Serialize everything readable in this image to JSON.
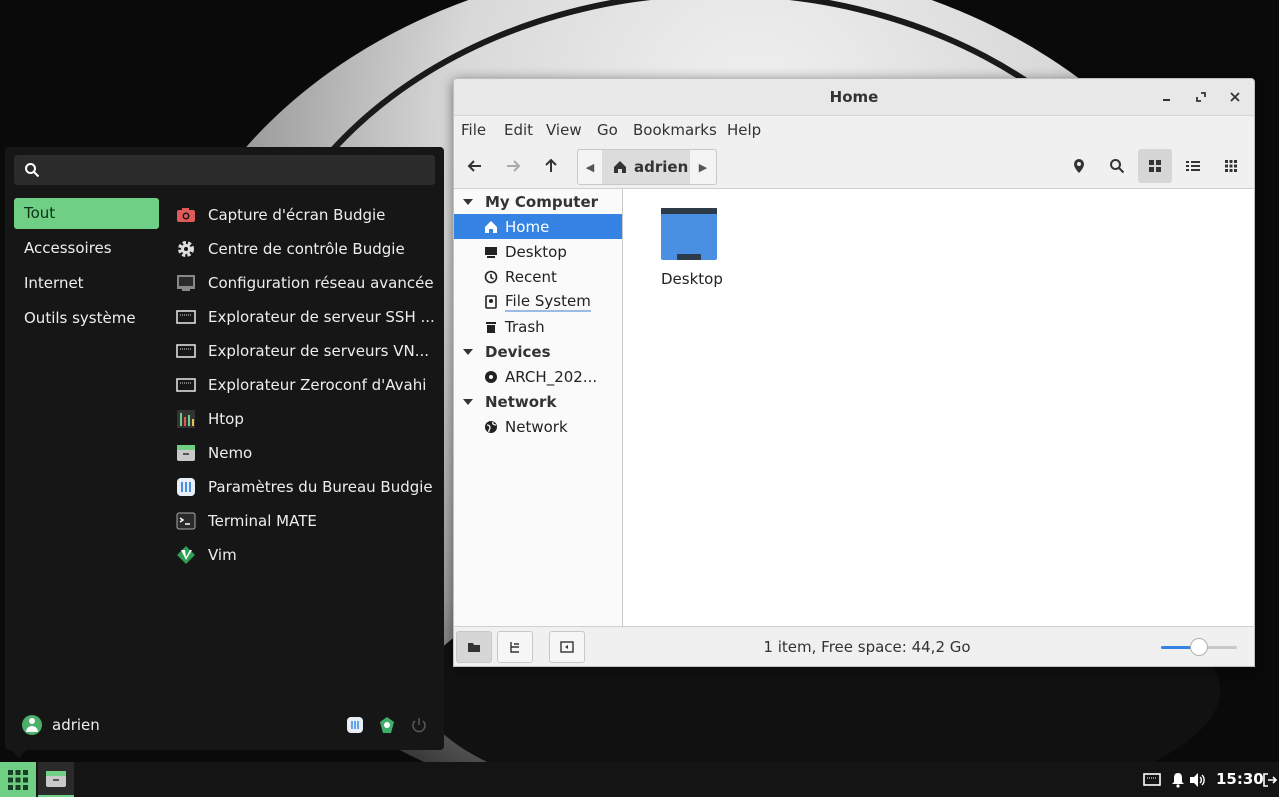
{
  "menu": {
    "search_placeholder": "",
    "categories": [
      "Tout",
      "Accessoires",
      "Internet",
      "Outils système"
    ],
    "apps": [
      {
        "label": "Capture d'écran Budgie",
        "icon": "screenshot-camera-icon"
      },
      {
        "label": "Centre de contrôle Budgie",
        "icon": "settings-gear-icon"
      },
      {
        "label": "Configuration réseau avancée",
        "icon": "network-config-icon"
      },
      {
        "label": "Explorateur de serveur SSH ...",
        "icon": "ssh-browser-icon"
      },
      {
        "label": "Explorateur de serveurs VN...",
        "icon": "vnc-browser-icon"
      },
      {
        "label": "Explorateur Zeroconf d'Avahi",
        "icon": "avahi-browser-icon"
      },
      {
        "label": "Htop",
        "icon": "htop-icon"
      },
      {
        "label": "Nemo",
        "icon": "file-manager-icon"
      },
      {
        "label": "Paramètres du Bureau Budgie",
        "icon": "desktop-settings-icon"
      },
      {
        "label": "Terminal MATE",
        "icon": "terminal-icon"
      },
      {
        "label": "Vim",
        "icon": "vim-icon"
      }
    ],
    "user": "adrien"
  },
  "window": {
    "title": "Home",
    "menubar": [
      "File",
      "Edit",
      "View",
      "Go",
      "Bookmarks",
      "Help"
    ],
    "breadcrumb": "adrien",
    "sidebar": {
      "sections": [
        {
          "title": "My Computer",
          "items": [
            "Home",
            "Desktop",
            "Recent",
            "File System",
            "Trash"
          ]
        },
        {
          "title": "Devices",
          "items": [
            "ARCH_202..."
          ]
        },
        {
          "title": "Network",
          "items": [
            "Network"
          ]
        }
      ]
    },
    "files": [
      {
        "label": "Desktop"
      }
    ],
    "status": "1 item, Free space: 44,2 Go",
    "zoom_level": 0.5
  },
  "panel": {
    "clock": "15:30"
  },
  "colors": {
    "accent": "#6fcf84",
    "selection": "#3584e4",
    "menu_bg": "#161616"
  }
}
